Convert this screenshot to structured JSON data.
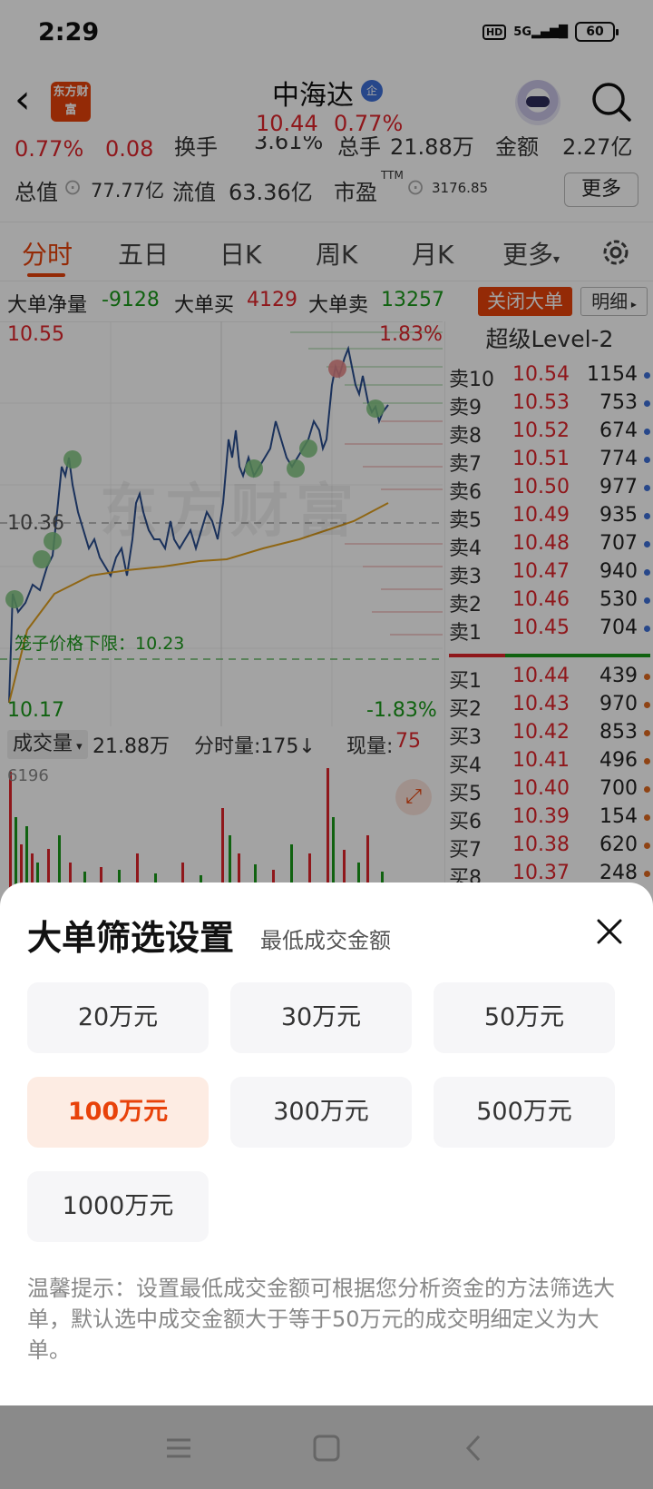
{
  "status_bar": {
    "time": "2:29",
    "hd": "HD",
    "network": "5G",
    "battery": "60"
  },
  "header": {
    "logo_text": "东方财富",
    "stock_name": "中海达",
    "badge": "企",
    "price": "10.44",
    "change_pct": "0.77%"
  },
  "quote": {
    "row1": {
      "pct": "0.77%",
      "change": "0.08",
      "turnover_label": "换手",
      "turnover": "3.61%",
      "volume_label": "总手",
      "volume": "21.88万",
      "amount_label": "金额",
      "amount": "2.27亿"
    },
    "row2": {
      "total_cap_label": "总值",
      "total_cap": "77.77亿",
      "float_cap_label": "流值",
      "float_cap": "63.36亿",
      "pe_label": "市盈",
      "pe_sup": "TTM",
      "pe": "3176.85"
    },
    "more_label": "更多"
  },
  "tabs": [
    "分时",
    "五日",
    "日K",
    "周K",
    "月K",
    "更多"
  ],
  "active_tab": "分时",
  "big_order": {
    "net_label": "大单净量",
    "net": "-9128",
    "buy_label": "大单买",
    "buy": "4129",
    "sell_label": "大单卖",
    "sell": "13257",
    "close_label": "关闭大单",
    "detail_label": "明细"
  },
  "chart_labels": {
    "high": "10.55",
    "high_pct": "1.83%",
    "mid": "10.36",
    "low": "10.17",
    "low_pct": "-1.83%",
    "limit_text": "笼子价格下限：10.23",
    "watermark": "东方财富"
  },
  "volume_bar": {
    "tag": "成交量",
    "total": "21.88万",
    "tick_label": "分时量:175",
    "now_label": "现量:",
    "now": "75",
    "max": "6196"
  },
  "order_book": {
    "title": "超级Level-2",
    "asks": [
      {
        "label": "卖10",
        "price": "10.54",
        "vol": "1154"
      },
      {
        "label": "卖9",
        "price": "10.53",
        "vol": "753"
      },
      {
        "label": "卖8",
        "price": "10.52",
        "vol": "674"
      },
      {
        "label": "卖7",
        "price": "10.51",
        "vol": "774"
      },
      {
        "label": "卖6",
        "price": "10.50",
        "vol": "977"
      },
      {
        "label": "卖5",
        "price": "10.49",
        "vol": "935"
      },
      {
        "label": "卖4",
        "price": "10.48",
        "vol": "707"
      },
      {
        "label": "卖3",
        "price": "10.47",
        "vol": "940"
      },
      {
        "label": "卖2",
        "price": "10.46",
        "vol": "530"
      },
      {
        "label": "卖1",
        "price": "10.45",
        "vol": "704"
      }
    ],
    "bids": [
      {
        "label": "买1",
        "price": "10.44",
        "vol": "439"
      },
      {
        "label": "买2",
        "price": "10.43",
        "vol": "970"
      },
      {
        "label": "买3",
        "price": "10.42",
        "vol": "853"
      },
      {
        "label": "买4",
        "price": "10.41",
        "vol": "496"
      },
      {
        "label": "买5",
        "price": "10.40",
        "vol": "700"
      },
      {
        "label": "买6",
        "price": "10.39",
        "vol": "154"
      },
      {
        "label": "买7",
        "price": "10.38",
        "vol": "620"
      },
      {
        "label": "买8",
        "price": "10.37",
        "vol": "248"
      }
    ]
  },
  "sheet": {
    "title": "大单筛选设置",
    "subtitle": "最低成交金额",
    "options": [
      "20万元",
      "30万元",
      "50万元",
      "100万元",
      "300万元",
      "500万元",
      "1000万元"
    ],
    "selected": "100万元",
    "tip": "温馨提示：设置最低成交金额可根据您分析资金的方法筛选大单，默认选中成交金额大于等于50万元的成交明细定义为大单。"
  },
  "colors": {
    "up": "#e0242b",
    "down": "#1a9a1a",
    "accent": "#e8420a",
    "price_line": "#2a4d8f",
    "avg_line": "#e0a020"
  }
}
